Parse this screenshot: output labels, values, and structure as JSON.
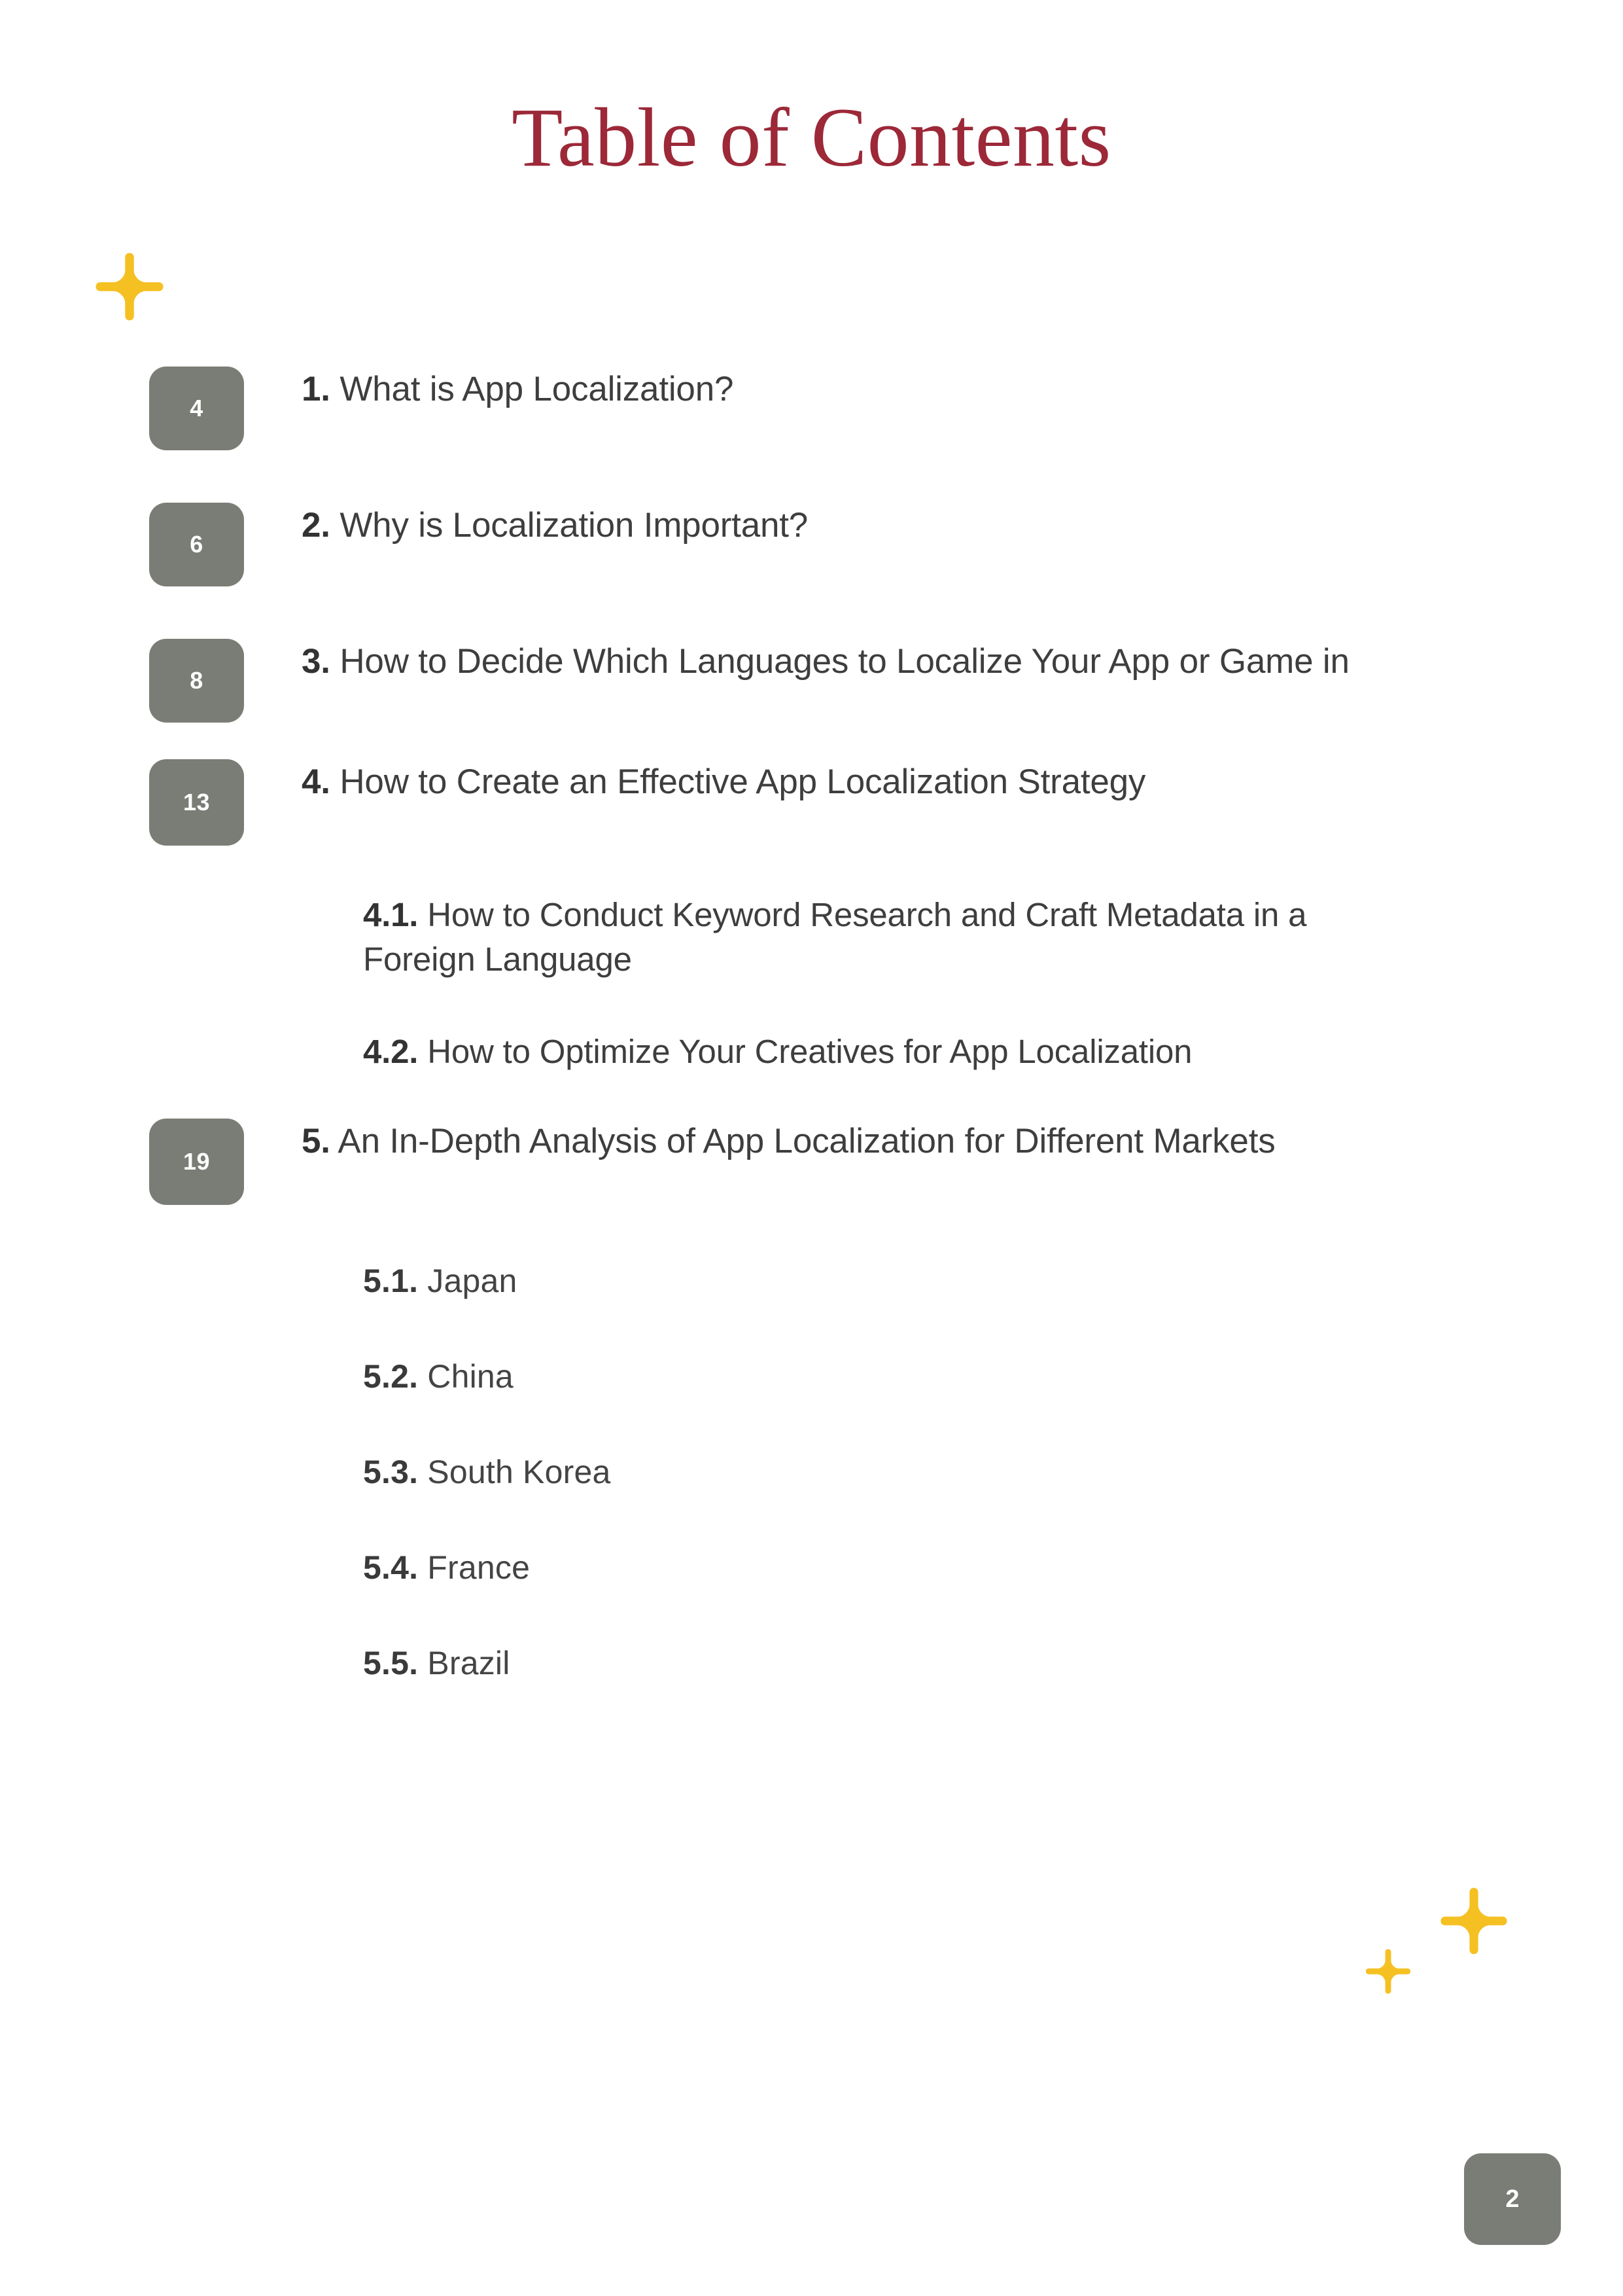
{
  "document": {
    "title": "Table of Contents",
    "page_number": "2"
  },
  "theme": {
    "title_color": "#9c2838",
    "badge_color": "#7a7d75",
    "text_color": "#3e3e3e",
    "sparkle_color": "#f5c022",
    "background": "#ffffff"
  },
  "decorations": [
    {
      "name": "sparkle-top-left",
      "icon": "sparkle-icon",
      "size": "large"
    },
    {
      "name": "sparkle-bottom-large",
      "icon": "sparkle-icon",
      "size": "large"
    },
    {
      "name": "sparkle-bottom-small",
      "icon": "sparkle-icon",
      "size": "small"
    }
  ],
  "toc": {
    "entries": [
      {
        "page": "4",
        "num": "1.",
        "label": "What is App Localization?"
      },
      {
        "page": "6",
        "num": "2.",
        "label": "Why is Localization Important?"
      },
      {
        "page": "8",
        "num": "3.",
        "label": "How to Decide Which Languages to Localize Your App or Game in"
      },
      {
        "page": "13",
        "num": "4.",
        "label": "How to Create an Effective App Localization Strategy"
      },
      {
        "page": "19",
        "num": "5.",
        "label": "An In-Depth Analysis of App Localization for Different Markets"
      }
    ],
    "subentries_4": [
      {
        "num": "4.1.",
        "label": "How to Conduct Keyword Research and Craft Metadata in a Foreign Language"
      },
      {
        "num": "4.2.",
        "label": "How to Optimize Your Creatives for App Localization"
      }
    ],
    "subentries_5": [
      {
        "num": "5.1.",
        "label": "Japan"
      },
      {
        "num": "5.2.",
        "label": "China"
      },
      {
        "num": "5.3.",
        "label": "South Korea"
      },
      {
        "num": "5.4.",
        "label": "France"
      },
      {
        "num": "5.5.",
        "label": "Brazil"
      }
    ]
  }
}
